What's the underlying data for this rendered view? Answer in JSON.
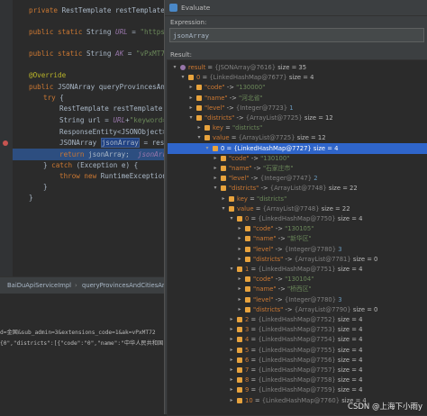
{
  "editor": {
    "lines": [
      {
        "kw": "private",
        "rest": " RestTemplate restTemplate;"
      },
      {
        "kw": "public static",
        "rest": " String ",
        "var": "URL",
        "tail": " = ",
        "s": "\"https://"
      },
      {
        "kw": "public static",
        "rest": " String ",
        "var": "AK",
        "tail": " = ",
        "s": "\"vPxMT721"
      },
      {
        "ann": "@Override"
      },
      {
        "kw": "public",
        "rest": " JSONArray queryProvincesAndCi"
      },
      {
        "kw": "try",
        "rest": " {"
      },
      {
        "rest": "RestTemplate restTemplate ="
      },
      {
        "rest": "String url = ",
        "var": "URL",
        "tail": "+",
        "s": "\"keyword="
      },
      {
        "rest": "ResponseEntity<JSONObject> r"
      },
      {
        "rest": "JSONArray ",
        "sel": "jsonArray",
        "tail": " = resul"
      },
      {
        "kw": "return",
        "rest": " jsonArray;  ",
        "it": "jsonArray"
      },
      {
        "rest": "} ",
        "kw": "catch",
        "tail": " (Exception e) {"
      },
      {
        "kw": "throw new",
        "rest": " RuntimeException("
      },
      {
        "rest": "}"
      },
      {
        "rest": "}"
      }
    ],
    "breadcrumb": {
      "class": "BaiDuApiServiceImpl",
      "method": "queryProvincesAndCitiesAnd"
    },
    "log": [
      "d=金国&sub_admin=3&extensions_code=1&ak=vPxMT72",
      "{0\",\"districts\":[{\"code\":\"0\",\"name\":\"中华人民共和国\",\"level\":0,\""
    ]
  },
  "dialog": {
    "title": "Evaluate",
    "expression_label": "Expression:",
    "expression_value": "jsonArray",
    "result_label": "Result:",
    "watermark": "CSDN @上海下小雨y",
    "rows": [
      {
        "d": 0,
        "tw": "▾",
        "ic": "r",
        "key": "result",
        "eq": " = ",
        "val": "{JSONArray@7616}",
        "size": "  size = 35"
      },
      {
        "d": 1,
        "tw": "▾",
        "ic": "f",
        "key": "0",
        "eq": " = ",
        "val": "{LinkedHashMap@7677}",
        "size": "  size = 4"
      },
      {
        "d": 2,
        "tw": "▸",
        "ic": "f",
        "key": "\"code\"",
        "eq": " -> ",
        "s": "\"130000\""
      },
      {
        "d": 2,
        "tw": "▸",
        "ic": "f",
        "key": "\"name\"",
        "eq": " -> ",
        "s": "\"河北省\""
      },
      {
        "d": 2,
        "tw": "▸",
        "ic": "f",
        "key": "\"level\"",
        "eq": " -> ",
        "val": "{Integer@7723} ",
        "n": "1"
      },
      {
        "d": 2,
        "tw": "▾",
        "ic": "f",
        "key": "\"districts\"",
        "eq": " -> ",
        "val": "{ArrayList@7725}",
        "size": "  size = 12"
      },
      {
        "d": 3,
        "tw": "▸",
        "ic": "f",
        "key": "key",
        "eq": " = ",
        "s": "\"districts\""
      },
      {
        "d": 3,
        "tw": "▾",
        "ic": "f",
        "key": "value",
        "eq": " = ",
        "val": "{ArrayList@7725}",
        "size": "  size = 12"
      },
      {
        "d": 4,
        "tw": "▾",
        "ic": "f",
        "key": "0",
        "eq": " = ",
        "val": "{LinkedHashMap@7727}",
        "size": "  size = 4",
        "sel": true
      },
      {
        "d": 5,
        "tw": "▸",
        "ic": "f",
        "key": "\"code\"",
        "eq": " -> ",
        "s": "\"130100\""
      },
      {
        "d": 5,
        "tw": "▸",
        "ic": "f",
        "key": "\"name\"",
        "eq": " -> ",
        "s": "\"石家庄市\""
      },
      {
        "d": 5,
        "tw": "▸",
        "ic": "f",
        "key": "\"level\"",
        "eq": " -> ",
        "val": "{Integer@7747} ",
        "n": "2"
      },
      {
        "d": 5,
        "tw": "▾",
        "ic": "f",
        "key": "\"districts\"",
        "eq": " -> ",
        "val": "{ArrayList@7748}",
        "size": "  size = 22"
      },
      {
        "d": 6,
        "tw": "▸",
        "ic": "f",
        "key": "key",
        "eq": " = ",
        "s": "\"districts\""
      },
      {
        "d": 6,
        "tw": "▾",
        "ic": "f",
        "key": "value",
        "eq": " = ",
        "val": "{ArrayList@7748}",
        "size": "  size = 22"
      },
      {
        "d": 7,
        "tw": "▾",
        "ic": "f",
        "key": "0",
        "eq": " = ",
        "val": "{LinkedHashMap@7750}",
        "size": "  size = 4"
      },
      {
        "d": 8,
        "tw": "▸",
        "ic": "f",
        "key": "\"code\"",
        "eq": " -> ",
        "s": "\"130105\""
      },
      {
        "d": 8,
        "tw": "▸",
        "ic": "f",
        "key": "\"name\"",
        "eq": " -> ",
        "s": "\"新华区\""
      },
      {
        "d": 8,
        "tw": "▸",
        "ic": "f",
        "key": "\"level\"",
        "eq": " -> ",
        "val": "{Integer@7780} ",
        "n": "3"
      },
      {
        "d": 8,
        "tw": "▸",
        "ic": "f",
        "key": "\"districts\"",
        "eq": " -> ",
        "val": "{ArrayList@7781}",
        "size": "  size = 0"
      },
      {
        "d": 7,
        "tw": "▾",
        "ic": "f",
        "key": "1",
        "eq": " = ",
        "val": "{LinkedHashMap@7751}",
        "size": "  size = 4"
      },
      {
        "d": 8,
        "tw": "▸",
        "ic": "f",
        "key": "\"code\"",
        "eq": " -> ",
        "s": "\"130104\""
      },
      {
        "d": 8,
        "tw": "▸",
        "ic": "f",
        "key": "\"name\"",
        "eq": " -> ",
        "s": "\"桥西区\""
      },
      {
        "d": 8,
        "tw": "▸",
        "ic": "f",
        "key": "\"level\"",
        "eq": " -> ",
        "val": "{Integer@7780} ",
        "n": "3"
      },
      {
        "d": 8,
        "tw": "▸",
        "ic": "f",
        "key": "\"districts\"",
        "eq": " -> ",
        "val": "{ArrayList@7790}",
        "size": "  size = 0"
      },
      {
        "d": 7,
        "tw": "▸",
        "ic": "f",
        "key": "2",
        "eq": " = ",
        "val": "{LinkedHashMap@7752}",
        "size": "  size = 4"
      },
      {
        "d": 7,
        "tw": "▸",
        "ic": "f",
        "key": "3",
        "eq": " = ",
        "val": "{LinkedHashMap@7753}",
        "size": "  size = 4"
      },
      {
        "d": 7,
        "tw": "▸",
        "ic": "f",
        "key": "4",
        "eq": " = ",
        "val": "{LinkedHashMap@7754}",
        "size": "  size = 4"
      },
      {
        "d": 7,
        "tw": "▸",
        "ic": "f",
        "key": "5",
        "eq": " = ",
        "val": "{LinkedHashMap@7755}",
        "size": "  size = 4"
      },
      {
        "d": 7,
        "tw": "▸",
        "ic": "f",
        "key": "6",
        "eq": " = ",
        "val": "{LinkedHashMap@7756}",
        "size": "  size = 4"
      },
      {
        "d": 7,
        "tw": "▸",
        "ic": "f",
        "key": "7",
        "eq": " = ",
        "val": "{LinkedHashMap@7757}",
        "size": "  size = 4"
      },
      {
        "d": 7,
        "tw": "▸",
        "ic": "f",
        "key": "8",
        "eq": " = ",
        "val": "{LinkedHashMap@7758}",
        "size": "  size = 4"
      },
      {
        "d": 7,
        "tw": "▸",
        "ic": "f",
        "key": "9",
        "eq": " = ",
        "val": "{LinkedHashMap@7759}",
        "size": "  size = 4"
      },
      {
        "d": 7,
        "tw": "▸",
        "ic": "f",
        "key": "10",
        "eq": " = ",
        "val": "{LinkedHashMap@7760}",
        "size": "  size = 4"
      }
    ]
  }
}
